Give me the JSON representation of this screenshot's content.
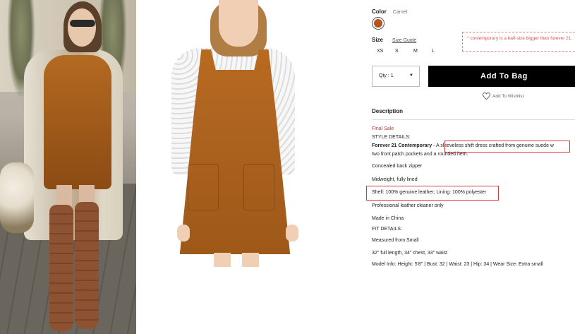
{
  "images": {
    "street_photo_alt": "",
    "product_photo_alt": ""
  },
  "color": {
    "label": "Color",
    "value": "Camel",
    "swatch_hex": "#b2561b"
  },
  "size": {
    "label": "Size",
    "guide_label": "Size Guide",
    "options": [
      "XS",
      "S",
      "M",
      "L"
    ],
    "note": "* contemporary is a half-size bigger than forever 21."
  },
  "purchase": {
    "qty_label": "Qty : 1",
    "add_to_bag": "Add To Bag",
    "wishlist": "Add To Wishlist"
  },
  "description": {
    "heading": "Description",
    "final_sale": "Final Sale",
    "style_details": "STYLE DETAILS:",
    "brand": "Forever 21 Contemporary",
    "dash": " - ",
    "summary_part1": "A sleeveless shift dress crafted from genuine suede",
    "summary_part2": " w",
    "summary_line2": "two front patch pockets and a rounded hem.",
    "zipper": "Concealed back zipper",
    "weight": "Midweight, fully lined",
    "material": "Shell: 100% genuine leather; Lining: 100% polyester",
    "care": "Professional leather cleaner only",
    "origin": "Made in China",
    "fit_details": "FIT DETAILS:",
    "measured": "Measured from Small",
    "measurements": "32\" full length, 34\" chest, 33\" waist",
    "model_info": "Model Info: Height: 5'8\" | Bust: 32 | Waist: 23 | Hip: 34 | Wear Size: Extra small"
  }
}
